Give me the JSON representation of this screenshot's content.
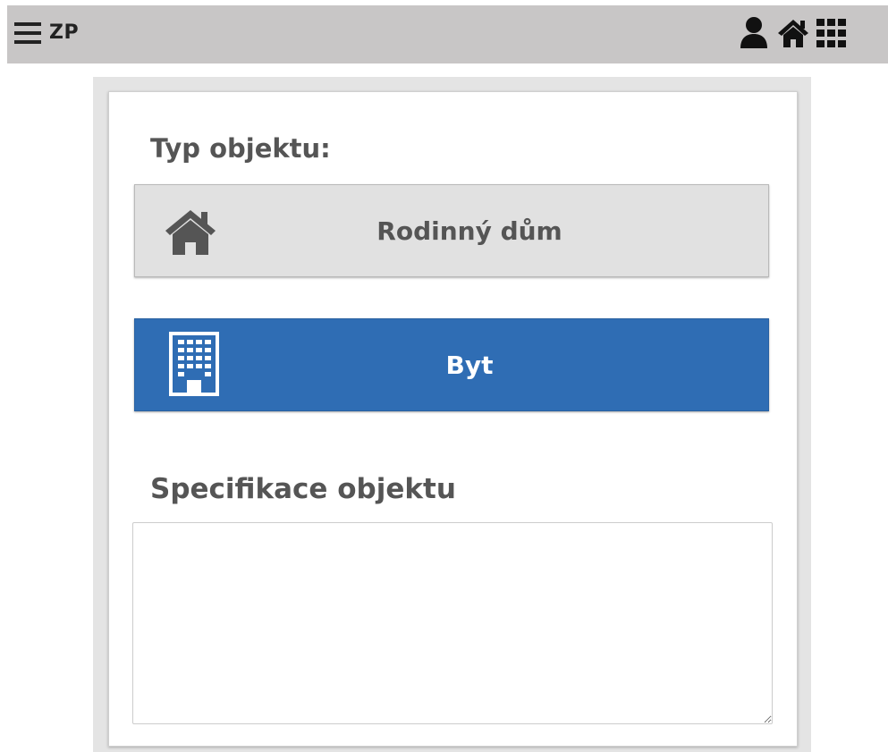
{
  "header": {
    "app_name": "ZP",
    "icons": [
      "menu-icon",
      "user-icon",
      "home-icon",
      "apps-grid-icon"
    ]
  },
  "form": {
    "type_heading": "Typ objektu:",
    "options": [
      {
        "label": "Rodinný dům",
        "icon": "house-icon",
        "selected": false
      },
      {
        "label": "Byt",
        "icon": "building-icon",
        "selected": true
      }
    ],
    "spec_heading": "Specifikace objektu",
    "spec_value": ""
  },
  "colors": {
    "topbar": "#c8c6c6",
    "selected": "#2f6db4",
    "unselected": "#e1e1e1",
    "text": "#555555"
  }
}
